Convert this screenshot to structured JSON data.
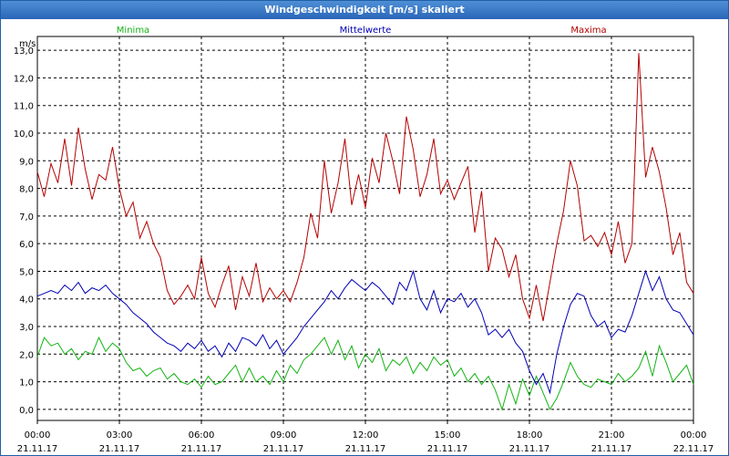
{
  "window": {
    "title": "Windgeschwindigkeit [m/s] skaliert"
  },
  "chart_data": {
    "type": "line",
    "ylabel": "m/s",
    "ylim": [
      -0.4,
      13.5
    ],
    "y_ticks": [
      "0,0",
      "1,0",
      "2,0",
      "3,0",
      "4,0",
      "5,0",
      "6,0",
      "7,0",
      "8,0",
      "9,0",
      "10,0",
      "11,0",
      "12,0",
      "13,0"
    ],
    "x_ticks": [
      {
        "time": "00:00",
        "date": "21.11.17"
      },
      {
        "time": "03:00",
        "date": "21.11.17"
      },
      {
        "time": "06:00",
        "date": "21.11.17"
      },
      {
        "time": "09:00",
        "date": "21.11.17"
      },
      {
        "time": "12:00",
        "date": "21.11.17"
      },
      {
        "time": "15:00",
        "date": "21.11.17"
      },
      {
        "time": "18:00",
        "date": "21.11.17"
      },
      {
        "time": "21:00",
        "date": "21.11.17"
      },
      {
        "time": "00:00",
        "date": "22.11.17"
      }
    ],
    "grid": true,
    "series": [
      {
        "name": "Minima",
        "color": "#14b414",
        "x": [
          0,
          0.25,
          0.5,
          0.75,
          1,
          1.25,
          1.5,
          1.75,
          2,
          2.25,
          2.5,
          2.75,
          3,
          3.25,
          3.5,
          3.75,
          4,
          4.25,
          4.5,
          4.75,
          5,
          5.25,
          5.5,
          5.75,
          6,
          6.25,
          6.5,
          6.75,
          7,
          7.25,
          7.5,
          7.75,
          8,
          8.25,
          8.5,
          8.75,
          9,
          9.25,
          9.5,
          9.75,
          10,
          10.25,
          10.5,
          10.75,
          11,
          11.25,
          11.5,
          11.75,
          12,
          12.25,
          12.5,
          12.75,
          13,
          13.25,
          13.5,
          13.75,
          14,
          14.25,
          14.5,
          14.75,
          15,
          15.25,
          15.5,
          15.75,
          16,
          16.25,
          16.5,
          16.75,
          17,
          17.25,
          17.5,
          17.75,
          18,
          18.25,
          18.5,
          18.75,
          19,
          19.25,
          19.5,
          19.75,
          20,
          20.25,
          20.5,
          20.75,
          21,
          21.25,
          21.5,
          21.75,
          22,
          22.25,
          22.5,
          22.75,
          23,
          23.25,
          23.5,
          23.75,
          24
        ],
        "values": [
          1.9,
          2.6,
          2.3,
          2.4,
          2.0,
          2.2,
          1.8,
          2.1,
          2.0,
          2.6,
          2.1,
          2.4,
          2.2,
          1.7,
          1.4,
          1.5,
          1.2,
          1.4,
          1.5,
          1.1,
          1.3,
          1.0,
          0.9,
          1.1,
          0.8,
          1.2,
          0.9,
          1.0,
          1.3,
          1.6,
          1.0,
          1.5,
          1.0,
          1.2,
          0.9,
          1.4,
          1.0,
          1.6,
          1.3,
          1.8,
          2.0,
          2.3,
          2.6,
          2.0,
          2.5,
          1.8,
          2.3,
          1.5,
          2.0,
          1.7,
          2.2,
          1.4,
          1.8,
          1.6,
          1.9,
          1.3,
          1.7,
          1.4,
          1.9,
          1.6,
          1.8,
          1.2,
          1.5,
          1.0,
          1.3,
          0.9,
          1.2,
          0.7,
          0.0,
          0.9,
          0.2,
          1.1,
          0.5,
          1.2,
          0.6,
          0.0,
          0.4,
          1.0,
          1.7,
          1.2,
          0.9,
          0.8,
          1.1,
          1.0,
          0.9,
          1.3,
          1.0,
          1.2,
          1.5,
          2.1,
          1.2,
          2.3,
          1.7,
          1.0,
          1.3,
          1.6,
          0.9
        ]
      },
      {
        "name": "Mittelwerte",
        "color": "#0000b4",
        "x": [
          0,
          0.25,
          0.5,
          0.75,
          1,
          1.25,
          1.5,
          1.75,
          2,
          2.25,
          2.5,
          2.75,
          3,
          3.25,
          3.5,
          3.75,
          4,
          4.25,
          4.5,
          4.75,
          5,
          5.25,
          5.5,
          5.75,
          6,
          6.25,
          6.5,
          6.75,
          7,
          7.25,
          7.5,
          7.75,
          8,
          8.25,
          8.5,
          8.75,
          9,
          9.25,
          9.5,
          9.75,
          10,
          10.25,
          10.5,
          10.75,
          11,
          11.25,
          11.5,
          11.75,
          12,
          12.25,
          12.5,
          12.75,
          13,
          13.25,
          13.5,
          13.75,
          14,
          14.25,
          14.5,
          14.75,
          15,
          15.25,
          15.5,
          15.75,
          16,
          16.25,
          16.5,
          16.75,
          17,
          17.25,
          17.5,
          17.75,
          18,
          18.25,
          18.5,
          18.75,
          19,
          19.25,
          19.5,
          19.75,
          20,
          20.25,
          20.5,
          20.75,
          21,
          21.25,
          21.5,
          21.75,
          22,
          22.25,
          22.5,
          22.75,
          23,
          23.25,
          23.5,
          23.75,
          24
        ],
        "values": [
          4.1,
          4.2,
          4.3,
          4.2,
          4.5,
          4.3,
          4.6,
          4.2,
          4.4,
          4.3,
          4.5,
          4.2,
          4.0,
          3.8,
          3.5,
          3.3,
          3.1,
          2.8,
          2.6,
          2.4,
          2.3,
          2.1,
          2.4,
          2.2,
          2.5,
          2.1,
          2.3,
          1.9,
          2.4,
          2.1,
          2.6,
          2.5,
          2.3,
          2.7,
          2.2,
          2.5,
          2.0,
          2.3,
          2.6,
          3.0,
          3.3,
          3.6,
          3.9,
          4.3,
          4.0,
          4.4,
          4.7,
          4.5,
          4.3,
          4.6,
          4.4,
          4.1,
          3.8,
          4.6,
          4.3,
          5.0,
          4.0,
          3.6,
          4.3,
          3.5,
          4.0,
          3.9,
          4.2,
          3.7,
          4.0,
          3.5,
          2.7,
          2.9,
          2.6,
          2.9,
          2.4,
          2.1,
          1.4,
          0.9,
          1.3,
          0.6,
          2.0,
          3.0,
          3.8,
          4.2,
          4.1,
          3.4,
          3.0,
          3.2,
          2.6,
          2.9,
          2.8,
          3.4,
          4.2,
          5.0,
          4.3,
          4.8,
          4.0,
          3.6,
          3.5,
          3.1,
          2.7
        ]
      },
      {
        "name": "Maxima",
        "color": "#b40000",
        "x": [
          0,
          0.25,
          0.5,
          0.75,
          1,
          1.25,
          1.5,
          1.75,
          2,
          2.25,
          2.5,
          2.75,
          3,
          3.25,
          3.5,
          3.75,
          4,
          4.25,
          4.5,
          4.75,
          5,
          5.25,
          5.5,
          5.75,
          6,
          6.25,
          6.5,
          6.75,
          7,
          7.25,
          7.5,
          7.75,
          8,
          8.25,
          8.5,
          8.75,
          9,
          9.25,
          9.5,
          9.75,
          10,
          10.25,
          10.5,
          10.75,
          11,
          11.25,
          11.5,
          11.75,
          12,
          12.25,
          12.5,
          12.75,
          13,
          13.25,
          13.5,
          13.75,
          14,
          14.25,
          14.5,
          14.75,
          15,
          15.25,
          15.5,
          15.75,
          16,
          16.25,
          16.5,
          16.75,
          17,
          17.25,
          17.5,
          17.75,
          18,
          18.25,
          18.5,
          18.75,
          19,
          19.25,
          19.5,
          19.75,
          20,
          20.25,
          20.5,
          20.75,
          21,
          21.25,
          21.5,
          21.75,
          22,
          22.25,
          22.5,
          22.75,
          23,
          23.25,
          23.5,
          23.75,
          24
        ],
        "values": [
          8.6,
          7.7,
          8.9,
          8.2,
          9.8,
          8.1,
          10.2,
          8.7,
          7.6,
          8.5,
          8.3,
          9.5,
          8.0,
          7.0,
          7.5,
          6.2,
          6.8,
          6.0,
          5.5,
          4.3,
          3.8,
          4.1,
          4.5,
          4.0,
          5.5,
          4.2,
          3.7,
          4.5,
          5.2,
          3.6,
          4.8,
          4.1,
          5.3,
          3.9,
          4.4,
          4.0,
          4.3,
          3.9,
          4.6,
          5.5,
          7.1,
          6.2,
          9.0,
          7.1,
          8.2,
          9.8,
          7.4,
          8.5,
          7.3,
          9.1,
          8.2,
          10.0,
          9.0,
          7.8,
          10.6,
          9.4,
          7.7,
          8.5,
          9.8,
          7.8,
          8.3,
          7.6,
          8.2,
          8.8,
          6.4,
          7.9,
          5.0,
          6.2,
          5.8,
          4.8,
          5.6,
          4.0,
          3.3,
          4.5,
          3.2,
          4.6,
          6.0,
          7.2,
          9.0,
          8.1,
          6.1,
          6.3,
          5.9,
          6.4,
          5.6,
          6.8,
          5.3,
          6.0,
          12.9,
          8.4,
          9.5,
          8.6,
          7.3,
          5.6,
          6.4,
          4.6,
          4.2
        ]
      }
    ]
  }
}
